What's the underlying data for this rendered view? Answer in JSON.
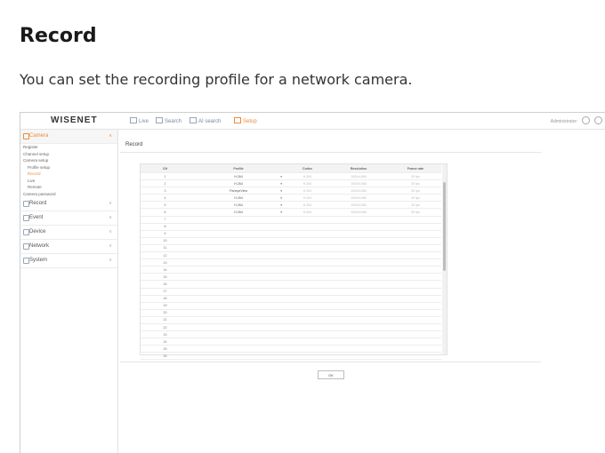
{
  "doc": {
    "title": "Record",
    "subtitle": "You can set the recording profile for a network camera."
  },
  "app": {
    "logo": "WISENET",
    "nav": [
      {
        "label": "Live",
        "icon": "monitor-icon"
      },
      {
        "label": "Search",
        "icon": "search-icon"
      },
      {
        "label": "AI search",
        "icon": "ai-search-icon"
      },
      {
        "label": "Setup",
        "icon": "setup-icon"
      }
    ],
    "user": "Administrator",
    "accent": "#ef8a3a"
  },
  "sidebar": {
    "sections": [
      {
        "label": "Camera",
        "items": [
          {
            "label": "Register"
          },
          {
            "label": "Channel setup"
          },
          {
            "label": "Camera setup"
          },
          {
            "label": "Profile setup"
          },
          {
            "label": "Record"
          },
          {
            "label": "Live"
          },
          {
            "label": "Remote"
          },
          {
            "label": "Camera password"
          }
        ]
      },
      {
        "label": "Record"
      },
      {
        "label": "Event"
      },
      {
        "label": "Device"
      },
      {
        "label": "Network"
      },
      {
        "label": "System"
      }
    ]
  },
  "main": {
    "title": "Record",
    "columns": [
      "CH",
      "Profile",
      "Codec",
      "Resolution",
      "Frame rate"
    ],
    "rows": [
      {
        "ch": "1",
        "profile": "H.264",
        "codec": "H.264",
        "resolution": "1920x1080",
        "fps": "30 fps"
      },
      {
        "ch": "2",
        "profile": "H.264",
        "codec": "H.264",
        "resolution": "1920x1080",
        "fps": "30 fps"
      },
      {
        "ch": "3",
        "profile": "FisheyeView",
        "codec": "H.264",
        "resolution": "1920x1080",
        "fps": "30 fps"
      },
      {
        "ch": "4",
        "profile": "H.264",
        "codec": "H.264",
        "resolution": "1920x1080",
        "fps": "30 fps"
      },
      {
        "ch": "5",
        "profile": "H.264",
        "codec": "H.264",
        "resolution": "1920x1080",
        "fps": "30 fps"
      },
      {
        "ch": "6",
        "profile": "H.264",
        "codec": "H.264",
        "resolution": "1920x1080",
        "fps": "30 fps"
      },
      {
        "ch": "7"
      },
      {
        "ch": "8"
      },
      {
        "ch": "9"
      },
      {
        "ch": "10"
      },
      {
        "ch": "11"
      },
      {
        "ch": "12"
      },
      {
        "ch": "13"
      },
      {
        "ch": "14"
      },
      {
        "ch": "15"
      },
      {
        "ch": "16"
      },
      {
        "ch": "17"
      },
      {
        "ch": "18"
      },
      {
        "ch": "19"
      },
      {
        "ch": "20"
      },
      {
        "ch": "21"
      },
      {
        "ch": "22"
      },
      {
        "ch": "23"
      },
      {
        "ch": "24"
      },
      {
        "ch": "25"
      },
      {
        "ch": "26"
      }
    ],
    "ok_label": "OK"
  }
}
